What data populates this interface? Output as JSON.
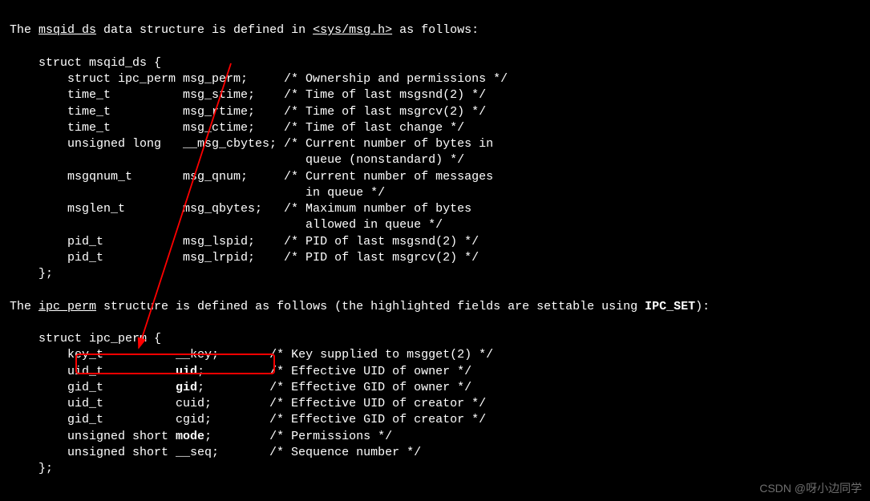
{
  "intro1_pre": "The ",
  "intro1_u1": "msqid_ds",
  "intro1_mid": " data structure is defined in ",
  "intro1_u2": "<sys/msg.h>",
  "intro1_post": " as follows:",
  "msqid": {
    "open": "    struct msqid_ds {",
    "l1": "        struct ipc_perm msg_perm;     /* Ownership and permissions */",
    "l2": "        time_t          msg_stime;    /* Time of last msgsnd(2) */",
    "l3": "        time_t          msg_rtime;    /* Time of last msgrcv(2) */",
    "l4": "        time_t          msg_ctime;    /* Time of last change */",
    "l5": "        unsigned long   __msg_cbytes; /* Current number of bytes in",
    "l5b": "                                         queue (nonstandard) */",
    "l6": "        msgqnum_t       msg_qnum;     /* Current number of messages",
    "l6b": "                                         in queue */",
    "l7": "        msglen_t        msg_qbytes;   /* Maximum number of bytes",
    "l7b": "                                         allowed in queue */",
    "l8": "        pid_t           msg_lspid;    /* PID of last msgsnd(2) */",
    "l9": "        pid_t           msg_lrpid;    /* PID of last msgrcv(2) */",
    "close": "    };"
  },
  "intro2_pre": "The ",
  "intro2_u1": "ipc_perm",
  "intro2_mid": " structure is defined as follows (the highlighted fields are settable using ",
  "intro2_b": "IPC_SET",
  "intro2_post": "):",
  "ipc": {
    "open": "    struct ipc_perm {",
    "k_t": "        key_t          ",
    "k_n": "__key;",
    "k_c": "       /* Key supplied to msgget(2) */",
    "u_t": "        uid_t          ",
    "u_n": "uid",
    "u_s": ";         /* Effective UID of owner */",
    "g_t": "        gid_t          ",
    "g_n": "gid",
    "g_s": ";         /* Effective GID of owner */",
    "cu": "        uid_t          cuid;        /* Effective UID of creator */",
    "cg": "        gid_t          cgid;        /* Effective GID of creator */",
    "m_t": "        unsigned short ",
    "m_n": "mode",
    "m_s": ";        /* Permissions */",
    "sq": "        unsigned short __seq;       /* Sequence number */",
    "close": "    };"
  },
  "watermark": "CSDN @呀小边同学"
}
